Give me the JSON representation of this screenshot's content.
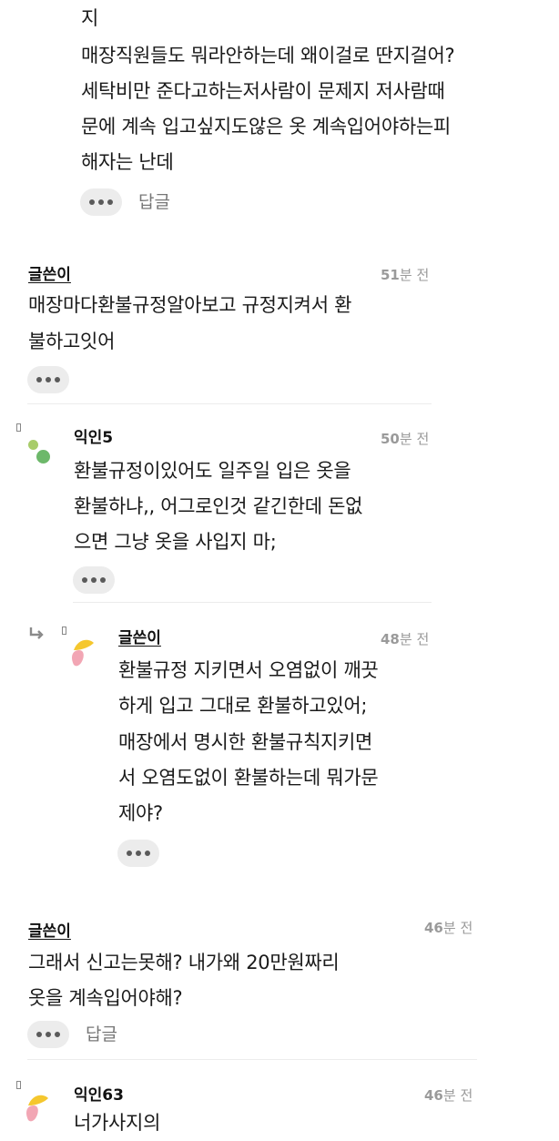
{
  "comments": [
    {
      "lines": [
        "지",
        "매장직원들도 뭐라안하는데 왜이걸로 딴지걸어?",
        "세탁비만 준다고하는저사람이 문제지 저사람때",
        "문에 계속 입고싶지도않은 옷 계속입어야하는피",
        "해자는 난데"
      ],
      "reply_label": "답글"
    },
    {
      "author": "글쓴이",
      "time_num": "51",
      "time_unit": "분 전",
      "lines": [
        "매장마다환불규정알아보고 규정지켜서 환",
        "불하고잇어"
      ]
    },
    {
      "author": "익인5",
      "time_num": "50",
      "time_unit": "분 전",
      "lines": [
        "환불규정이있어도 일주일 입은 옷을",
        "환불하냐,, 어그로인것 같긴한데 돈없",
        "으면 그냥 옷을 사입지 마;"
      ]
    },
    {
      "author": "글쓴이",
      "time_num": "48",
      "time_unit": "분 전",
      "lines": [
        "환불규정 지키면서 오염없이 깨끗",
        "하게 입고 그대로 환불하고있어;",
        "매장에서 명시한 환불규칙지키면",
        "서 오염도없이 환불하는데 뭐가문",
        "제야?"
      ]
    },
    {
      "author": "글쓴이",
      "time_num": "46",
      "time_unit": "분 전",
      "lines": [
        "그래서 신고는못해? 내가왜 20만원짜리",
        "옷을 계속입어야해?"
      ],
      "reply_label": "답글"
    },
    {
      "author": "익인63",
      "time_num": "46",
      "time_unit": "분 전",
      "lines": [
        "너가사지의"
      ]
    }
  ],
  "colors": {
    "green_dot_light": "#a8cc6a",
    "green_dot_dark": "#6db86a",
    "avatar_yellow": "#f5c72e",
    "avatar_pink": "#f2a6b4",
    "reply_arrow": "#8a8a8a"
  }
}
